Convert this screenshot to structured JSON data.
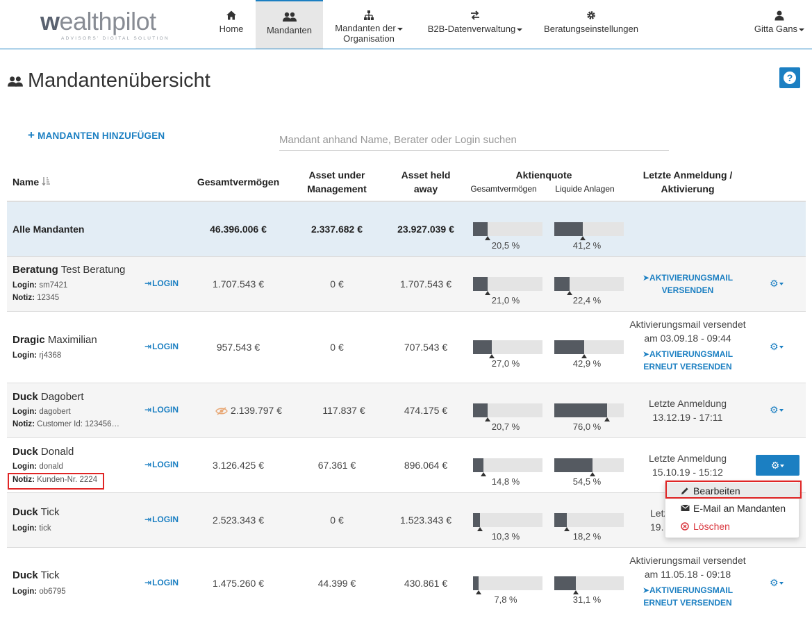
{
  "brand": {
    "logo_text": "wealthpilot",
    "logo_sub": "ADVISORS' DIGITAL SOLUTION"
  },
  "nav": {
    "home": "Home",
    "mandanten": "Mandanten",
    "org_line1": "Mandanten der",
    "org_line2": "Organisation",
    "b2b": "B2B-Datenverwaltung",
    "settings": "Beratungseinstellungen",
    "user": "Gitta Gans"
  },
  "page": {
    "title": "Mandantenübersicht",
    "add_label": "MANDANTEN HINZUFÜGEN",
    "search_placeholder": "Mandant anhand Name, Berater oder Login suchen"
  },
  "columns": {
    "name": "Name",
    "gesamt": "Gesamtvermögen",
    "aum_1": "Asset under",
    "aum_2": "Management",
    "held_1": "Asset held",
    "held_2": "away",
    "aktienquote": "Aktienquote",
    "sub_gesamt": "Gesamtvermögen",
    "sub_liquide": "Liquide Anlagen",
    "letzte_1": "Letzte Anmeldung /",
    "letzte_2": "Aktivierung"
  },
  "labels": {
    "login": "Login:",
    "notiz": "Notiz:",
    "login_btn": "LOGIN"
  },
  "total": {
    "name": "Alle Mandanten",
    "gesamt": "46.396.006 €",
    "aum": "2.337.682 €",
    "held": "23.927.039 €",
    "q1": 20.5,
    "q1_label": "20,5 %",
    "q2": 41.2,
    "q2_label": "41,2 %"
  },
  "rows": [
    {
      "last": "Beratung",
      "first": "Test Beratung",
      "login": "sm7421",
      "notiz": "12345",
      "gesamt": "1.707.543 €",
      "aum": "0 €",
      "held": "1.707.543 €",
      "q1": 21.0,
      "q1_label": "21,0 %",
      "q2": 22.4,
      "q2_label": "22,4 %",
      "act_link_1": "AKTIVIERUNGSMAIL",
      "act_link_2": "VERSENDEN"
    },
    {
      "last": "Dragic",
      "first": "Maximilian",
      "login": "rj4368",
      "gesamt": "957.543 €",
      "aum": "0 €",
      "held": "707.543 €",
      "q1": 27.0,
      "q1_label": "27,0 %",
      "q2": 42.9,
      "q2_label": "42,9 %",
      "act_text_1": "Aktivierungsmail versendet",
      "act_text_2": "am 03.09.18 - 09:44",
      "act_link_1": "AKTIVIERUNGSMAIL",
      "act_link_2": "ERNEUT VERSENDEN"
    },
    {
      "last": "Duck",
      "first": "Dagobert",
      "login": "dagobert",
      "notiz": "Customer Id: 123456…",
      "gesamt": "2.139.797 €",
      "aum": "117.837 €",
      "held": "474.175 €",
      "q1": 20.7,
      "q1_label": "20,7 %",
      "q2": 76.0,
      "q2_label": "76,0 %",
      "act_text_1": "Letzte Anmeldung",
      "act_text_2": "13.12.19 - 17:11"
    },
    {
      "last": "Duck",
      "first": "Donald",
      "login": "donald",
      "notiz": "Kunden-Nr. 2224",
      "gesamt": "3.126.425 €",
      "aum": "67.361 €",
      "held": "896.064 €",
      "q1": 14.8,
      "q1_label": "14,8 %",
      "q2": 54.5,
      "q2_label": "54,5 %",
      "act_text_1": "Letzte Anmeldung",
      "act_text_2": "15.10.19 - 15:12"
    },
    {
      "last": "Duck",
      "first": "Tick",
      "login": "tick",
      "gesamt": "2.523.343 €",
      "aum": "0 €",
      "held": "1.523.343 €",
      "q1": 10.3,
      "q1_label": "10,3 %",
      "q2": 18.2,
      "q2_label": "18,2 %",
      "act_text_1": "Letz",
      "act_text_2": "19."
    },
    {
      "last": "Duck",
      "first": "Tick",
      "login": "ob6795",
      "gesamt": "1.475.260 €",
      "aum": "44.399 €",
      "held": "430.861 €",
      "q1": 7.8,
      "q1_label": "7,8 %",
      "q2": 31.1,
      "q2_label": "31,1 %",
      "act_text_1": "Aktivierungsmail versendet",
      "act_text_2": "am 11.05.18 - 09:18",
      "act_link_1": "AKTIVIERUNGSMAIL",
      "act_link_2": "ERNEUT VERSENDEN"
    }
  ],
  "dropdown": {
    "edit": "Bearbeiten",
    "email": "E-Mail an Mandanten",
    "delete": "Löschen"
  },
  "colors": {
    "accent": "#1b7fc2",
    "bar_fill": "#555a61",
    "bar_bg": "#e4e4e4",
    "danger": "#d9363e",
    "highlight": "#e02525"
  }
}
